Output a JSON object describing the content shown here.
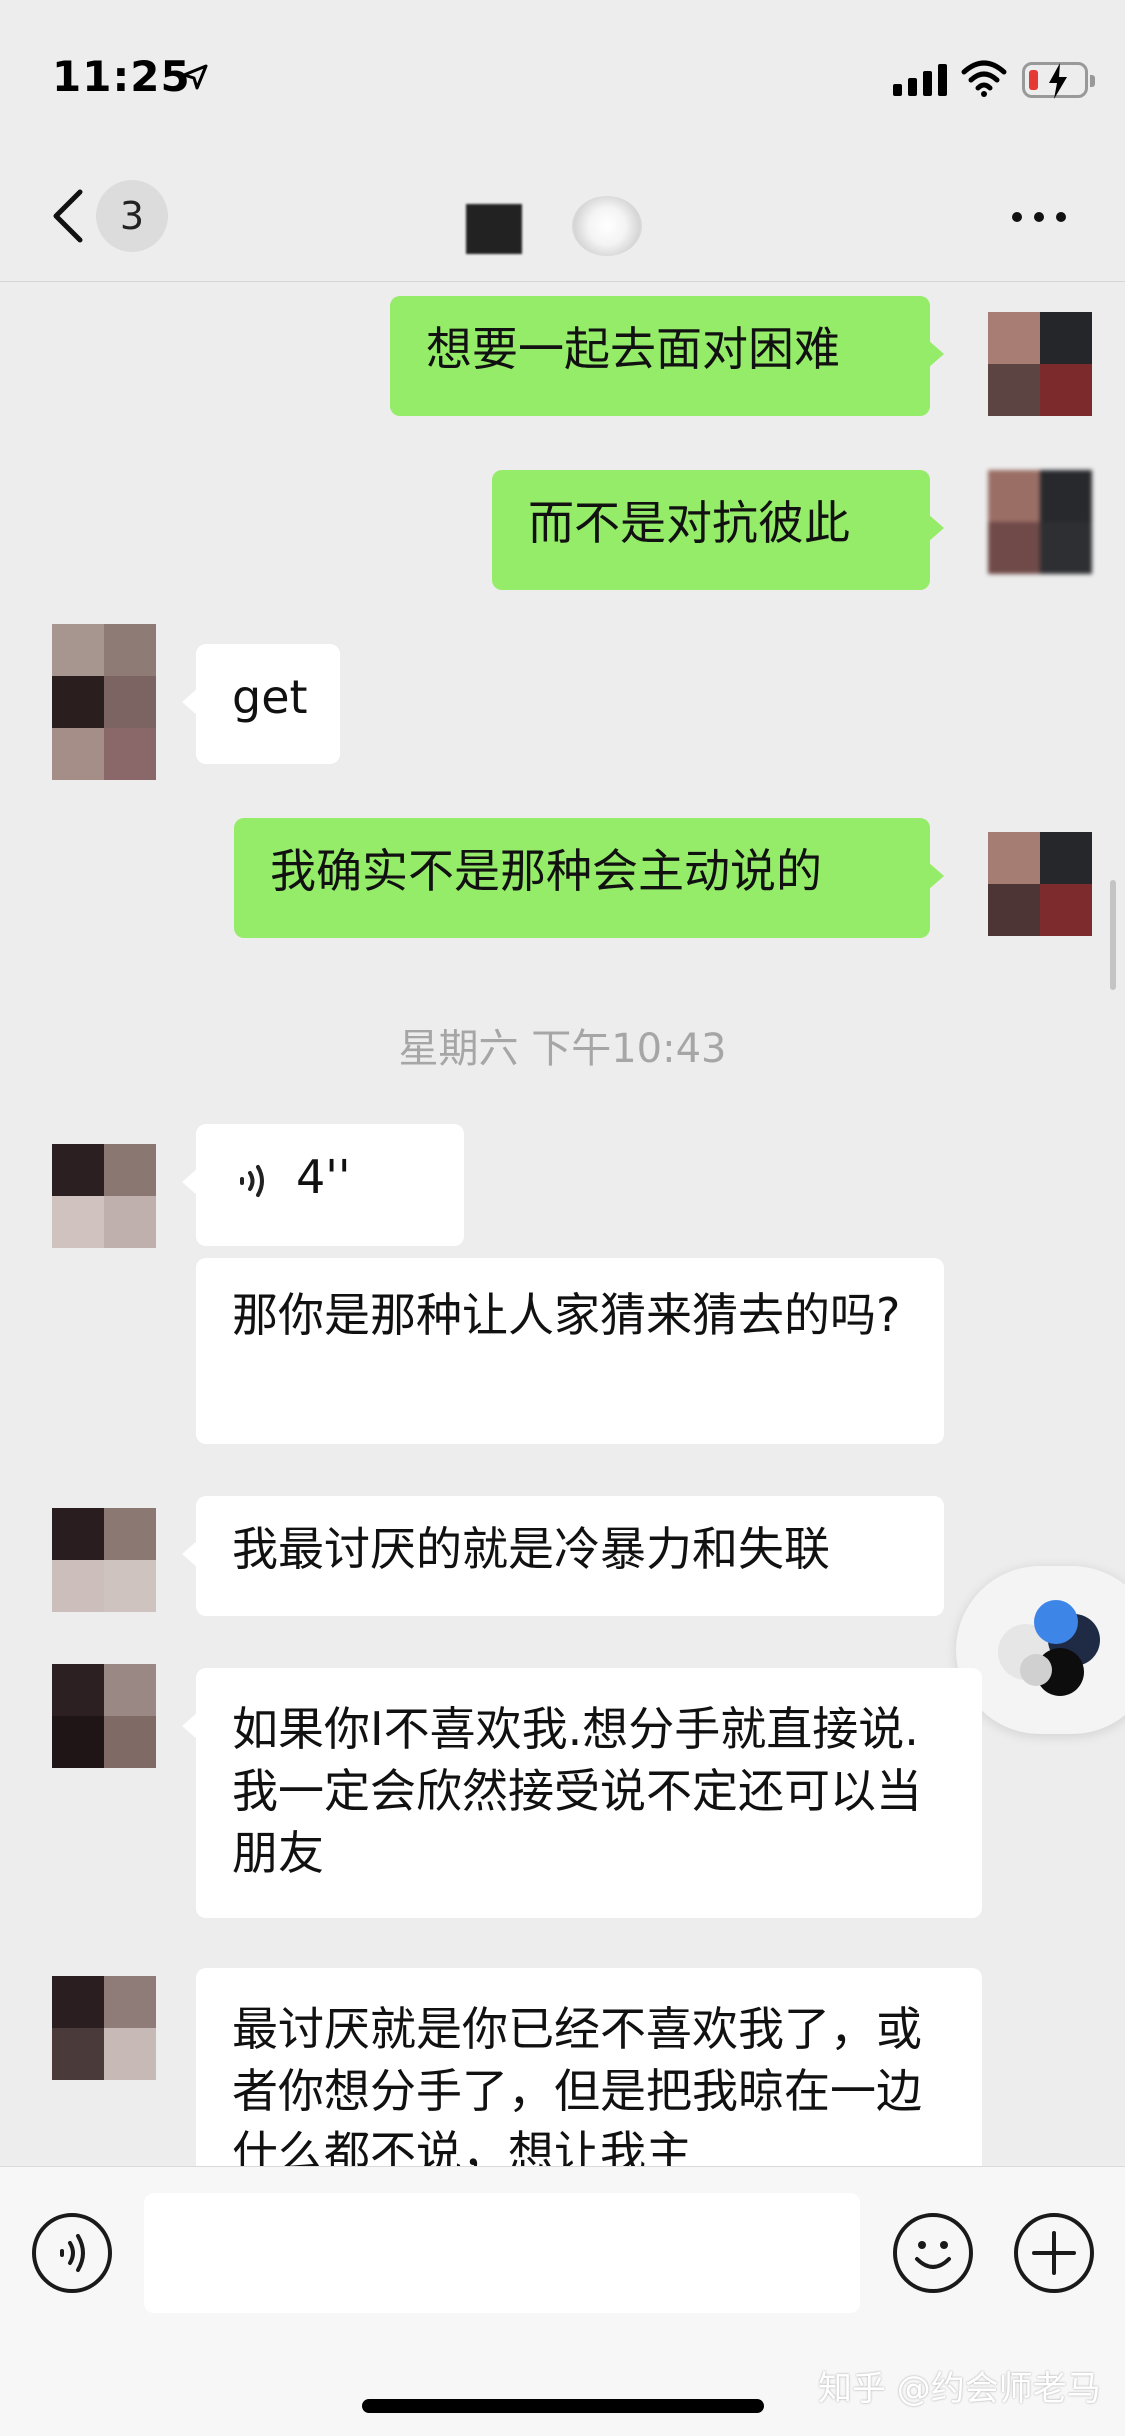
{
  "status_bar": {
    "time": "11:25"
  },
  "nav": {
    "unread_count": "3"
  },
  "messages": [
    {
      "text": "想要一起去面对困难"
    },
    {
      "text": "而不是对抗彼此"
    },
    {
      "text": "get"
    },
    {
      "text": "我确实不是那种会主动说的"
    },
    {
      "text": "4''"
    },
    {
      "text": "那你是那种让人家猜来猜去的吗?"
    },
    {
      "text": "我最讨厌的就是冷暴力和失联"
    },
    {
      "text": "如果你I不喜欢我.想分手就直接说.我一定会欣然接受说不定还可以当朋友"
    },
    {
      "text": "最讨厌就是你已经不喜欢我了，或者你想分手了，但是把我晾在一边什么都不说，想让我主"
    }
  ],
  "timestamp": "星期六 下午10:43",
  "watermark": "知乎 @约会师老马",
  "colors": {
    "outgoing_bubble": "#95ec69",
    "incoming_bubble": "#ffffff",
    "background": "#ededed"
  }
}
